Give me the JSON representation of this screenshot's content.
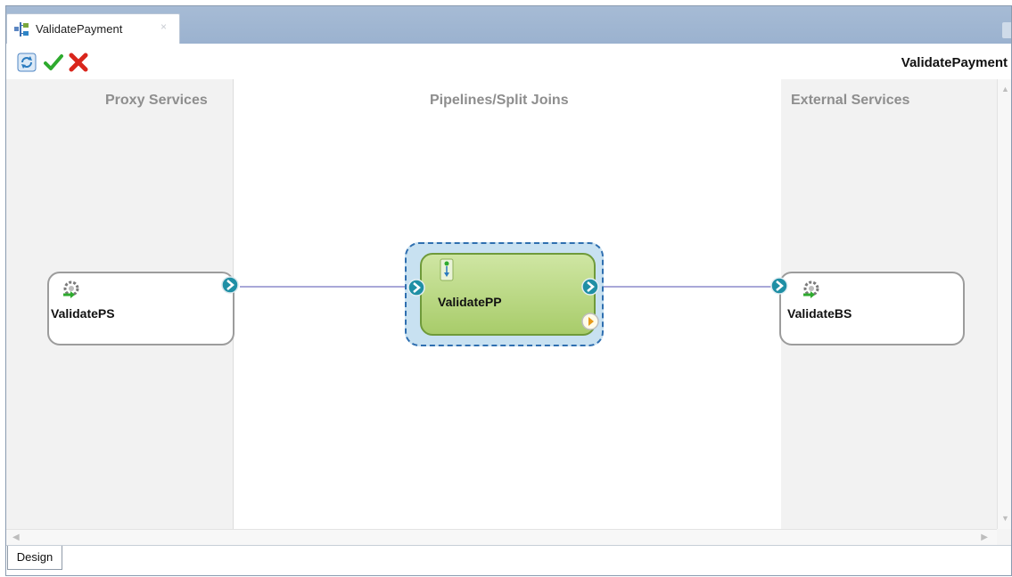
{
  "editor_tab": {
    "label": "ValidatePayment",
    "close_glyph": "×"
  },
  "toolbar": {
    "title": "ValidatePayment",
    "buttons": [
      {
        "name": "refresh-icon",
        "color": "#2b7bbf"
      },
      {
        "name": "validate-check-icon",
        "color": "#2eaa2e"
      },
      {
        "name": "delete-x-icon",
        "color": "#d9261c"
      }
    ]
  },
  "lanes": {
    "proxy": {
      "title": "Proxy Services"
    },
    "pipelines": {
      "title": "Pipelines/Split Joins"
    },
    "external": {
      "title": "External Services"
    }
  },
  "nodes": {
    "proxy_service": {
      "label": "ValidatePS",
      "icon": "gear-service-icon"
    },
    "pipeline": {
      "label": "ValidatePP",
      "icon": "pipeline-flow-icon"
    },
    "business_service": {
      "label": "ValidateBS",
      "icon": "gear-service-icon"
    }
  },
  "bottom_tabs": [
    {
      "label": "Design",
      "active": true
    }
  ],
  "colors": {
    "port": "#1f8fa5",
    "wire": "#a9a8d8",
    "pipeline_fill": "#b6d67f",
    "selection_outline": "#2f6fb0",
    "error_port": "#e69a1a"
  }
}
